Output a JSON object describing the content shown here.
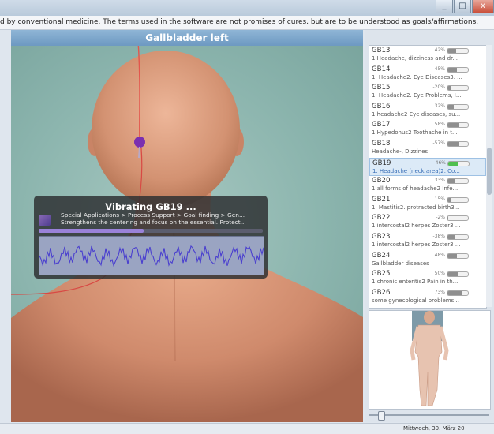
{
  "window": {
    "controls": [
      "_",
      "□",
      "x"
    ]
  },
  "disclaimer": "d by conventional medicine. The terms used in the software are not promises of cures, but are to be understood as goals/affirmations.",
  "viewer": {
    "title": "Gallbladder left"
  },
  "overlay": {
    "title": "Vibrating GB19 ...",
    "path": "Special Applications > Process Support > Goal finding > Gen...",
    "description": "Strengthens the centering and focus on the essential. Protect...",
    "progress": 0.47
  },
  "points": {
    "items": [
      {
        "code": "GB13",
        "pct": "42%",
        "level": 0.42,
        "desc": "1 Headache, dizziness and dr..."
      },
      {
        "code": "GB14",
        "pct": "45%",
        "level": 0.45,
        "desc": "1. Headache2. Eye Diseases3. ..."
      },
      {
        "code": "GB15",
        "pct": "-20%",
        "level": 0.2,
        "desc": "1. Headache2. Eye Problems, I..."
      },
      {
        "code": "GB16",
        "pct": "32%",
        "level": 0.32,
        "desc": "1 headache2 Eye diseases, su..."
      },
      {
        "code": "GB17",
        "pct": "58%",
        "level": 0.58,
        "desc": "1 Hypedonus2 Toothache in t..."
      },
      {
        "code": "GB18",
        "pct": "-57%",
        "level": 0.57,
        "desc": "Headache-, Dizzines"
      },
      {
        "code": "GB19",
        "pct": "46%",
        "level": 0.46,
        "desc": "1. Headache (neck area)2. Co...",
        "selected": true
      },
      {
        "code": "GB20",
        "pct": "33%",
        "level": 0.33,
        "desc": "1 all forms of headache2 Infe..."
      },
      {
        "code": "GB21",
        "pct": "15%",
        "level": 0.15,
        "desc": "1. Mastitis2. protracted birth3..."
      },
      {
        "code": "GB22",
        "pct": "-2%",
        "level": 0.02,
        "desc": "1 intercostal2 herpes Zoster3 ..."
      },
      {
        "code": "GB23",
        "pct": "-38%",
        "level": 0.38,
        "desc": "1 intercostal2 herpes Zoster3 ..."
      },
      {
        "code": "GB24",
        "pct": "48%",
        "level": 0.48,
        "desc": "Gallbladder diseases"
      },
      {
        "code": "GB25",
        "pct": "50%",
        "level": 0.5,
        "desc": "1 chronic enteritis2 Pain in th..."
      },
      {
        "code": "GB26",
        "pct": "73%",
        "level": 0.73,
        "desc": "some gynecological problems..."
      }
    ]
  },
  "status": {
    "date": "Mittwoch, 30. März 20"
  }
}
